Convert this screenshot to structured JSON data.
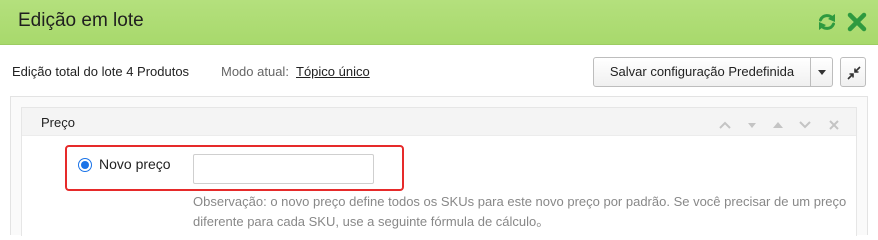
{
  "window": {
    "title": "Edição em lote",
    "refresh_icon": "refresh-icon",
    "close_icon": "close-icon",
    "accent_color": "#a8d96c"
  },
  "toolbar": {
    "summary": "Edição total do lote 4 Produtos",
    "mode_label": "Modo atual:",
    "mode_value": "Tópico único",
    "save_button_label": "Salvar configuração Predefinida",
    "caret_icon": "chevron-down-icon",
    "collapse_icon": "collapse-arrows-icon"
  },
  "section": {
    "title": "Preço",
    "controls": [
      "chevron-up-icon",
      "chevron-down-icon",
      "arrow-up-icon",
      "arrow-down-icon",
      "close-icon"
    ],
    "option": {
      "label": "Novo preço",
      "selected": true,
      "input_value": "",
      "input_placeholder": ""
    },
    "note": "Observação: o novo preço define todos os SKUs para este novo preço por padrão. Se você precisar de um preço diferente para cada SKU, use a seguinte fórmula de cálculo。",
    "highlight_color": "#e62a2a"
  }
}
